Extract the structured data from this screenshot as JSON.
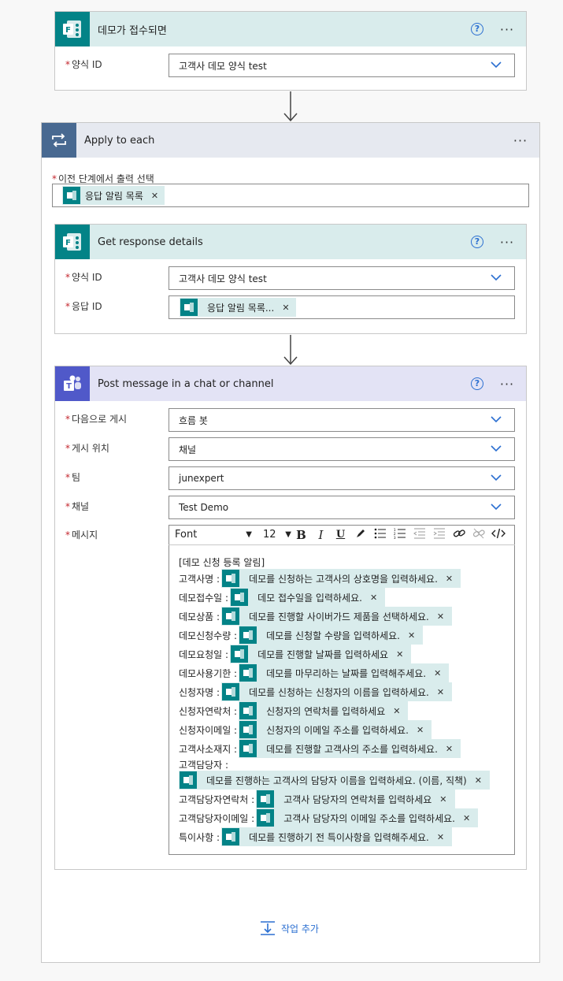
{
  "trigger": {
    "title": "데모가 접수되면",
    "form_id_label": "양식 ID",
    "form_id_value": "고객사 데모 양식 test"
  },
  "loop": {
    "title": "Apply to each",
    "select_output_label": "이전 단계에서 출력 선택",
    "select_output_token": "응답 알림 목록"
  },
  "get_response": {
    "title": "Get response details",
    "form_id_label": "양식 ID",
    "form_id_value": "고객사 데모 양식 test",
    "response_id_label": "응답 ID",
    "response_id_token": "응답 알림 목록..."
  },
  "post_message": {
    "title": "Post message in a chat or channel",
    "post_as_label": "다음으로 게시",
    "post_as_value": "흐름 봇",
    "post_in_label": "게시 위치",
    "post_in_value": "채널",
    "team_label": "팀",
    "team_value": "junexpert",
    "channel_label": "채널",
    "channel_value": "Test Demo",
    "message_label": "메시지",
    "toolbar": {
      "font": "Font",
      "size": "12",
      "bold": "B",
      "italic": "I",
      "underline": "U"
    },
    "message_heading": "[데모 신청 등록 알림]",
    "lines": [
      {
        "label": "고객사명 :",
        "token": "데모를 신청하는 고객사의 상호명을 입력하세요."
      },
      {
        "label": "데모접수일 :",
        "token": "데모 접수일을 입력하세요."
      },
      {
        "label": "데모상품 :",
        "token": "데모를 진행할 사이버가드 제품을 선택하세요."
      },
      {
        "label": "데모신청수량 :",
        "token": "데모를 신청할 수량을 입력하세요."
      },
      {
        "label": "데모요청일 :",
        "token": "데모를 진행할 날짜를 입력하세요"
      },
      {
        "label": "데모사용기한 :",
        "token": "데모를 마무리하는 날짜를 입력해주세요."
      },
      {
        "label": "신청자명 :",
        "token": "데모를 신청하는 신청자의 이름을 입력하세요."
      },
      {
        "label": "신청자연락처 :",
        "token": "신청자의 연락처를 입력하세요"
      },
      {
        "label": "신청자이메일 :",
        "token": "신청자의 이메일 주소를 입력하세요."
      },
      {
        "label": "고객사소재지 :",
        "token": "데모를 진행할 고객사의 주소를 입력하세요."
      },
      {
        "label": "고객담당자 :",
        "token": ""
      },
      {
        "label": "",
        "token": "데모를 진행하는 고객사의 담당자 이름을 입력하세요. (이름, 직책)"
      },
      {
        "label": "고객담당자연락처 :",
        "token": "고객사 담당자의 연락처를 입력하세요"
      },
      {
        "label": "고객담당자이메일 :",
        "token": "고객사 담당자의 이메일 주소를 입력하세요."
      },
      {
        "label": "특이사항 :",
        "token": "데모를 진행하기 전 특이사항을 입력해주세요."
      }
    ]
  },
  "add_action": {
    "label": "작업 추가"
  },
  "colors": {
    "forms_teal": "#038387",
    "teams_purple": "#5059c9",
    "loop_blue": "#486991",
    "header_teal_bg": "#d9ecec",
    "header_purple_bg": "#e3e3f5",
    "header_gray_bg": "#e6e9f0",
    "link_blue": "#2b6fd1",
    "required_red": "#c4262e"
  },
  "icons": {
    "forms": "forms-icon",
    "loop": "loop-icon",
    "teams": "teams-icon",
    "help": "help-icon",
    "more": "more-icon",
    "chevron": "chevron-down-icon",
    "remove": "close-icon"
  }
}
